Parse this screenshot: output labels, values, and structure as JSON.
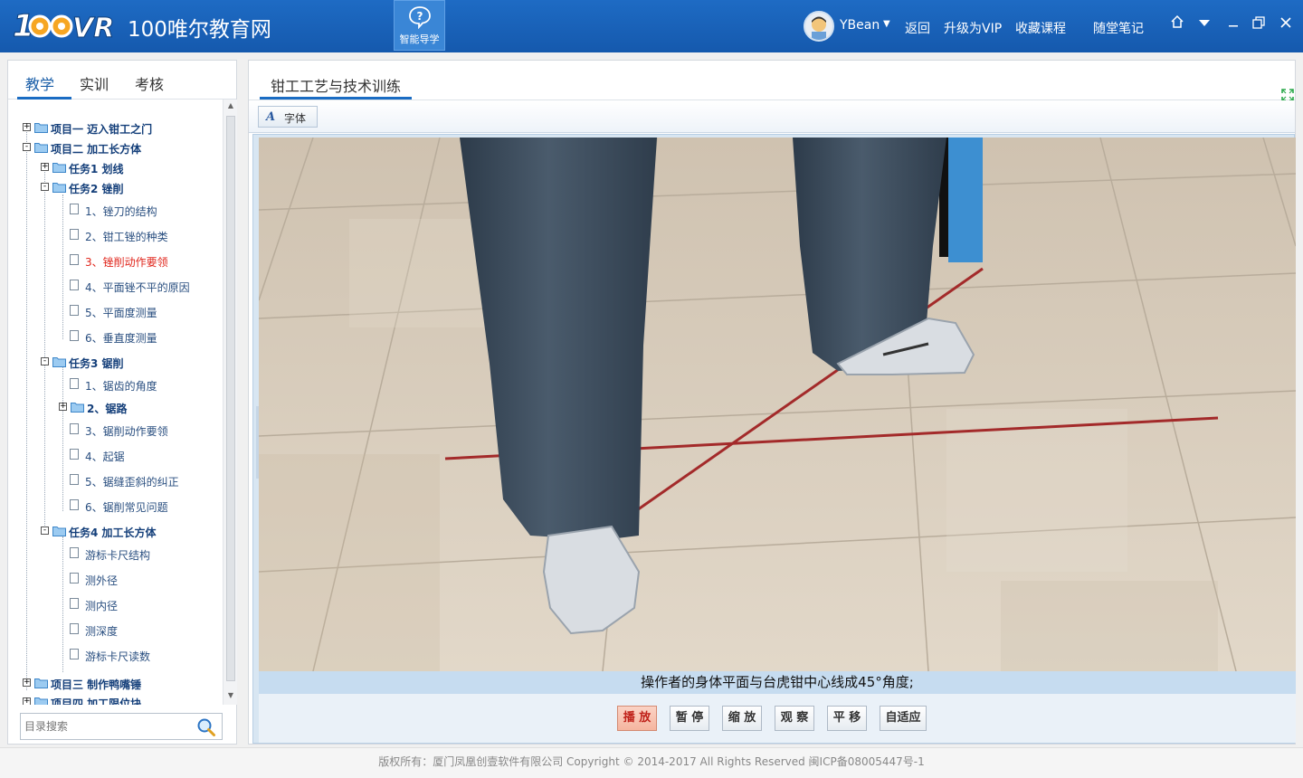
{
  "header": {
    "site_name": "100唯尔教育网",
    "guide_label": "智能导学",
    "username": "YBean",
    "links": {
      "back": "返回",
      "upgrade": "升级为VIP",
      "favorites": "收藏课程",
      "notes": "随堂笔记"
    },
    "icons": [
      "home-icon",
      "dropdown-icon",
      "minimize-icon",
      "maximize-icon",
      "close-icon"
    ]
  },
  "sidebar": {
    "tabs": [
      "教学",
      "实训",
      "考核"
    ],
    "active_tab": "教学",
    "tree": [
      {
        "label": "项目一  迈入钳工之门",
        "level": 0,
        "type": "folder",
        "toggle": "+"
      },
      {
        "label": "项目二  加工长方体",
        "level": 0,
        "type": "folder",
        "toggle": "-"
      },
      {
        "label": "任务1  划线",
        "level": 1,
        "type": "folder",
        "toggle": "+"
      },
      {
        "label": "任务2  锉削",
        "level": 1,
        "type": "folder",
        "toggle": "-"
      },
      {
        "label": "1、锉刀的结构",
        "level": 2,
        "type": "doc"
      },
      {
        "label": "2、钳工锉的种类",
        "level": 2,
        "type": "doc"
      },
      {
        "label": "3、锉削动作要领",
        "level": 2,
        "type": "doc",
        "current": true
      },
      {
        "label": "4、平面锉不平的原因",
        "level": 2,
        "type": "doc"
      },
      {
        "label": "5、平面度测量",
        "level": 2,
        "type": "doc"
      },
      {
        "label": "6、垂直度测量",
        "level": 2,
        "type": "doc"
      },
      {
        "label": "任务3  锯削",
        "level": 1,
        "type": "folder",
        "toggle": "-"
      },
      {
        "label": "1、锯齿的角度",
        "level": 2,
        "type": "doc"
      },
      {
        "label": "2、锯路",
        "level": 2,
        "type": "folder",
        "toggle": "+"
      },
      {
        "label": "3、锯削动作要领",
        "level": 2,
        "type": "doc"
      },
      {
        "label": "4、起锯",
        "level": 2,
        "type": "doc"
      },
      {
        "label": "5、锯缝歪斜的纠正",
        "level": 2,
        "type": "doc"
      },
      {
        "label": "6、锯削常见问题",
        "level": 2,
        "type": "doc"
      },
      {
        "label": "任务4  加工长方体",
        "level": 1,
        "type": "folder",
        "toggle": "-"
      },
      {
        "label": "游标卡尺结构",
        "level": 2,
        "type": "doc"
      },
      {
        "label": "测外径",
        "level": 2,
        "type": "doc"
      },
      {
        "label": "测内径",
        "level": 2,
        "type": "doc"
      },
      {
        "label": "测深度",
        "level": 2,
        "type": "doc"
      },
      {
        "label": "游标卡尺读数",
        "level": 2,
        "type": "doc"
      },
      {
        "label": "项目三  制作鸭嘴锤",
        "level": 0,
        "type": "folder",
        "toggle": "+"
      },
      {
        "label": "项目四  加工限位块",
        "level": 0,
        "type": "folder",
        "toggle": "+"
      }
    ],
    "search_placeholder": "目录搜索"
  },
  "main": {
    "course_title": "钳工工艺与技术训练",
    "font_button": "字体",
    "caption": "操作者的身体平面与台虎钳中心线成45°角度;",
    "controls": [
      "播 放",
      "暂 停",
      "缩 放",
      "观 察",
      "平 移",
      "自适应"
    ],
    "active_control": "播 放"
  },
  "footer": {
    "text": "版权所有：厦门凤凰创壹软件有限公司   Copyright © 2014-2017   All Rights Reserved   闽ICP备08005447号-1"
  },
  "colors": {
    "header_bg": "#1559ad",
    "accent": "#1a6cc3",
    "current_item": "#e0261c",
    "pants": "#3a4a5a",
    "floor": "#d9cdbb",
    "guide_line": "#a32a2a"
  }
}
